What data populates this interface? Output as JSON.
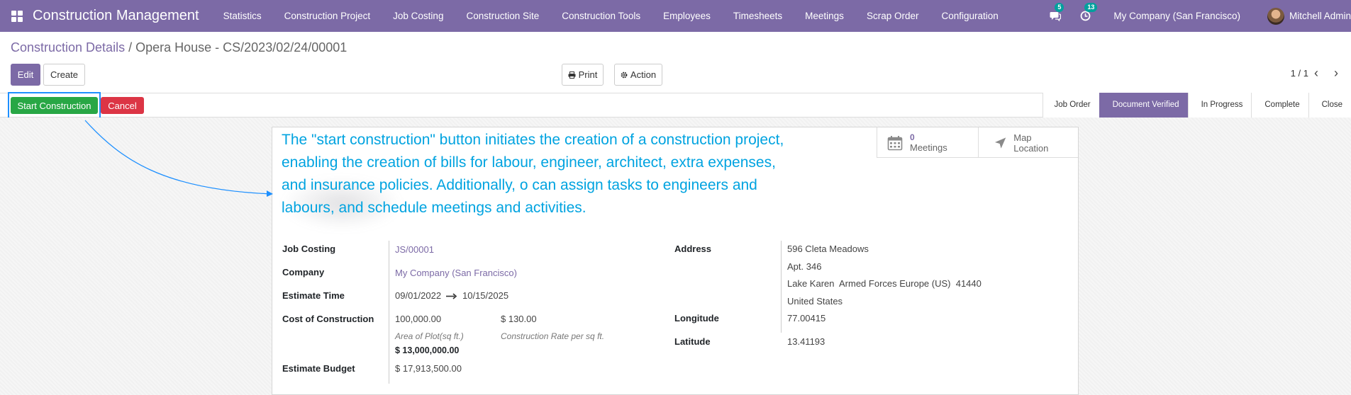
{
  "navbar": {
    "brand": "Construction Management",
    "menu": [
      "Statistics",
      "Construction Project",
      "Job Costing",
      "Construction Site",
      "Construction Tools",
      "Employees",
      "Timesheets",
      "Meetings",
      "Scrap Order",
      "Configuration"
    ],
    "messages_count": "5",
    "activities_count": "13",
    "company": "My Company (San Francisco)",
    "user": "Mitchell Admin"
  },
  "breadcrumb": {
    "parent": "Construction Details",
    "separator": " / ",
    "current": "Opera House - CS/2023/02/24/00001"
  },
  "toolbar": {
    "edit": "Edit",
    "create": "Create",
    "print": "Print",
    "action": "Action",
    "pager": "1 / 1"
  },
  "statusbar": {
    "start": "Start Construction",
    "cancel": "Cancel",
    "stages": [
      "Job Order",
      "Document Verified",
      "In Progress",
      "Complete",
      "Close"
    ],
    "active_stage": "Document Verified"
  },
  "smart_buttons": {
    "meetings_count": "0",
    "meetings_label": "Meetings",
    "map_label": "Map Location"
  },
  "annotation": {
    "line1": "The \"start construction\" button initiates the creation of a construction project,",
    "line2": "enabling the creation of bills for labour, engineer, architect, extra expenses,",
    "line3": "and insurance policies. Additionally, o can assign tasks to engineers and",
    "line4": "labours, and schedule meetings and activities."
  },
  "form": {
    "job_costing_label": "Job Costing",
    "job_costing": "JS/00001",
    "company_label": "Company",
    "company": "My Company (San Francisco)",
    "estimate_time_label": "Estimate Time",
    "estimate_start": "09/01/2022",
    "estimate_end": "10/15/2025",
    "cost_label": "Cost of Construction",
    "area": "100,000.00",
    "rate": "$ 130.00",
    "area_help": "Area of Plot(sq ft.)",
    "rate_help": "Construction Rate per sq ft.",
    "cost_total": "$ 13,000,000.00",
    "budget_label": "Estimate Budget",
    "budget": "$ 17,913,500.00",
    "address_label": "Address",
    "street": "596 Cleta Meadows",
    "street2": "Apt. 346",
    "city_line": "Lake Karen  Armed Forces Europe (US)  41440",
    "country": "United States",
    "longitude_label": "Longitude",
    "longitude": "77.00415",
    "latitude_label": "Latitude",
    "latitude": "13.41193"
  },
  "colors": {
    "brand": "#7c6aa6",
    "success": "#28a745",
    "danger": "#dc3545",
    "annotation": "#00a3e0"
  }
}
